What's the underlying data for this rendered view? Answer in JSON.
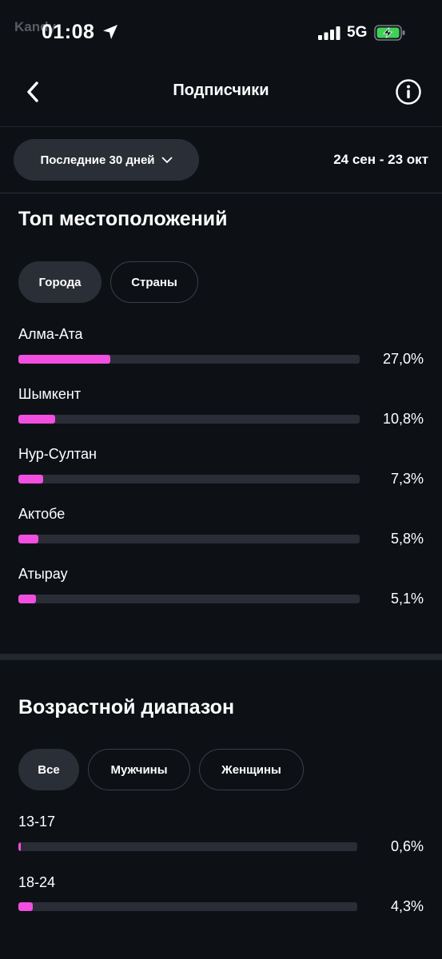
{
  "status_bar": {
    "watermark": "Kandy",
    "time": "01:08",
    "network": "5G"
  },
  "nav": {
    "title": "Подписчики"
  },
  "filter": {
    "period_label": "Последние 30 дней",
    "date_range": "24 сен - 23 окт"
  },
  "locations": {
    "title": "Топ местоположений",
    "tabs": [
      {
        "label": "Города",
        "active": true
      },
      {
        "label": "Страны",
        "active": false
      }
    ],
    "rows": [
      {
        "label": "Алма-Ата",
        "value": "27,0%",
        "fraction": 0.27
      },
      {
        "label": "Шымкент",
        "value": "10,8%",
        "fraction": 0.108
      },
      {
        "label": "Нур-Султан",
        "value": "7,3%",
        "fraction": 0.073
      },
      {
        "label": "Актобе",
        "value": "5,8%",
        "fraction": 0.058
      },
      {
        "label": "Атырау",
        "value": "5,1%",
        "fraction": 0.051
      }
    ]
  },
  "age": {
    "title": "Возрастной диапазон",
    "tabs": [
      {
        "label": "Все",
        "active": true
      },
      {
        "label": "Мужчины",
        "active": false
      },
      {
        "label": "Женщины",
        "active": false
      }
    ],
    "rows": [
      {
        "label": "13-17",
        "value": "0,6%",
        "fraction": 0.006
      },
      {
        "label": "18-24",
        "value": "4,3%",
        "fraction": 0.043
      }
    ]
  },
  "colors": {
    "background": "#0d1116",
    "accent": "#f24ee0",
    "track": "#2a2d35",
    "chip": "#2a2e36"
  },
  "icons": [
    "location-arrow-icon",
    "signal-icon",
    "battery-charging-icon",
    "back-chevron-icon",
    "info-icon",
    "chevron-down-icon"
  ]
}
